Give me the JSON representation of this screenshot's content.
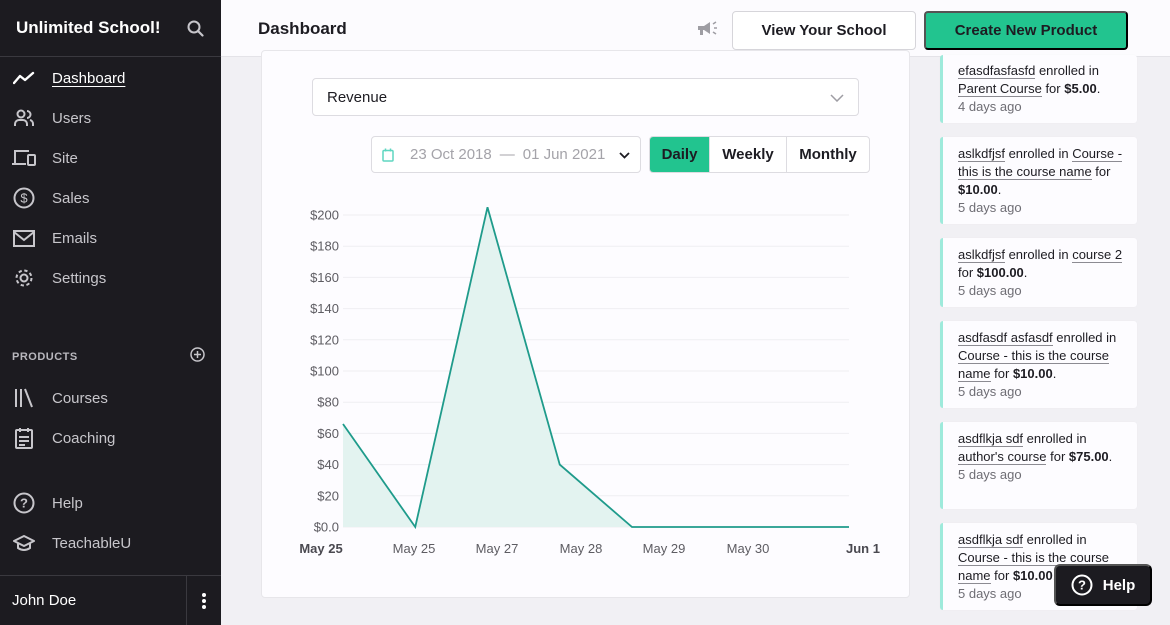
{
  "sidebar": {
    "school_name": "Unlimited School!",
    "search_icon": "search-icon",
    "nav": [
      {
        "label": "Dashboard",
        "icon": "trend-line-icon",
        "active": true
      },
      {
        "label": "Users",
        "icon": "users-icon"
      },
      {
        "label": "Site",
        "icon": "devices-icon"
      },
      {
        "label": "Sales",
        "icon": "dollar-circle-icon"
      },
      {
        "label": "Emails",
        "icon": "envelope-icon"
      },
      {
        "label": "Settings",
        "icon": "gear-icon"
      }
    ],
    "products_section": {
      "title": "PRODUCTS",
      "add_icon": "plus-circle-icon",
      "items": [
        {
          "label": "Courses",
          "icon": "library-icon"
        },
        {
          "label": "Coaching",
          "icon": "calendar-notes-icon"
        }
      ]
    },
    "support": [
      {
        "label": "Help",
        "icon": "question-circle-icon"
      },
      {
        "label": "TeachableU",
        "icon": "graduation-cap-icon"
      }
    ],
    "user_name": "John Doe",
    "more_icon": "vertical-dots-icon"
  },
  "topbar": {
    "title": "Dashboard",
    "announcements_icon": "megaphone-icon",
    "view_school_label": "View Your School",
    "create_product_label": "Create New Product"
  },
  "filters": {
    "metric": "Revenue",
    "date_from": "23 Oct 2018",
    "date_separator": "—",
    "date_to": "01 Jun 2021",
    "periods": [
      "Daily",
      "Weekly",
      "Monthly"
    ],
    "active_period": "Daily"
  },
  "chart_data": {
    "type": "area",
    "title": "Revenue",
    "x": [
      "May 25",
      "May 25",
      "May 27",
      "May 28",
      "May 29",
      "May 30",
      "Jun 1"
    ],
    "x_bold": [
      true,
      false,
      false,
      false,
      false,
      false,
      true
    ],
    "series": [
      {
        "name": "Revenue",
        "values": [
          66,
          0,
          205,
          40,
          0,
          0,
          0
        ],
        "color": "#1f9b8b",
        "fill": "#e3f3f0"
      }
    ],
    "point_x_index": [
      0,
      1,
      2,
      3,
      4,
      4.62,
      6
    ],
    "y_ticks": [
      "$0.0",
      "$20",
      "$40",
      "$60",
      "$80",
      "$100",
      "$120",
      "$140",
      "$160",
      "$180",
      "$200"
    ],
    "ylim": [
      0,
      200
    ],
    "grid": true,
    "xlabel": "",
    "ylabel": ""
  },
  "feed": [
    {
      "user": "efasdfasfasfd",
      "verb": " enrolled in ",
      "course": "Parent Course",
      "for": " for ",
      "amount": "$5.00",
      "time": "4 days ago"
    },
    {
      "user": "aslkdfjsf",
      "verb": " enrolled in ",
      "course": "Course - this is the course name",
      "for": " for ",
      "amount": "$10.00",
      "time": "5 days ago"
    },
    {
      "user": "aslkdfjsf",
      "verb": " enrolled in ",
      "course": "course 2",
      "for": " for ",
      "amount": "$100.00",
      "time": "5 days ago"
    },
    {
      "user": "asdfasdf asfasdf",
      "verb": " enrolled in ",
      "course": "Course - this is the course name",
      "for": " for ",
      "amount": "$10.00",
      "time": "5 days ago"
    },
    {
      "user": "asdflkja sdf",
      "verb": " enrolled in ",
      "course": "author's course",
      "for": " for ",
      "amount": "$75.00",
      "time": "5 days ago"
    },
    {
      "user": "asdflkja sdf",
      "verb": " enrolled in ",
      "course": "Course - this is the course name",
      "for": " for ",
      "amount": "$10.00",
      "time": "5 days ago"
    }
  ],
  "help_button": {
    "label": "Help",
    "icon": "question-circle-icon"
  },
  "colors": {
    "accent": "#22c48f",
    "sidebar_bg": "#1c1b20",
    "chart_line": "#1f9b8b",
    "chart_fill": "#e3f3f0",
    "feed_border": "#9eeadb"
  }
}
